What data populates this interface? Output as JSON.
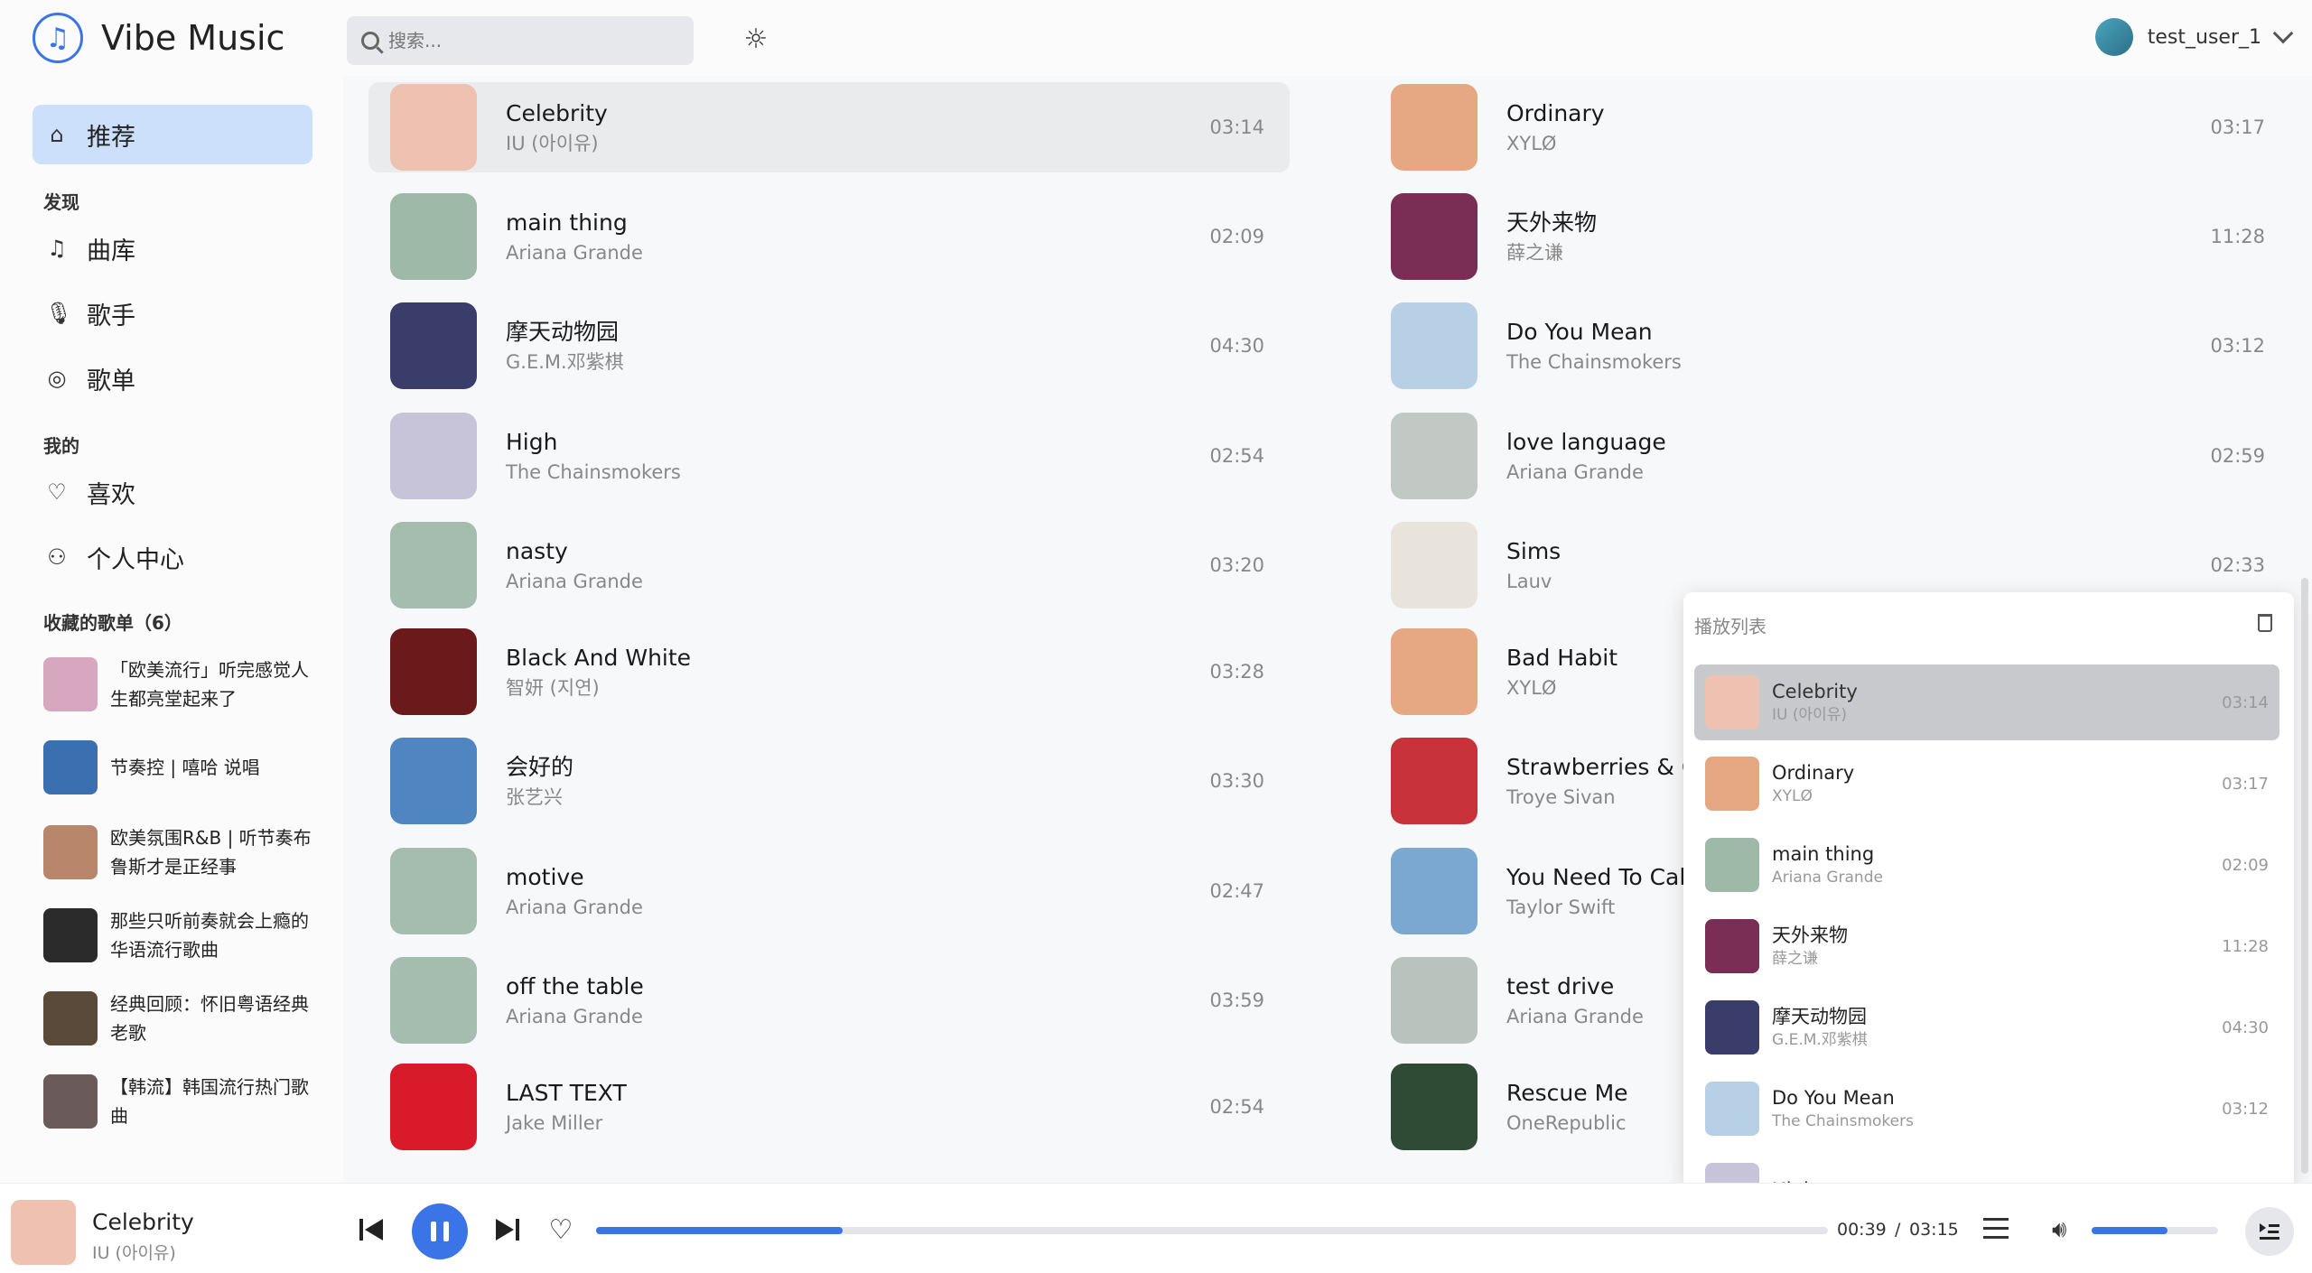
{
  "header": {
    "app_name": "Vibe Music",
    "search_placeholder": "搜索...",
    "username": "test_user_1"
  },
  "sidebar": {
    "recommend": "推荐",
    "discover_label": "发现",
    "library": "曲库",
    "artists": "歌手",
    "playlists": "歌单",
    "mine_label": "我的",
    "likes": "喜欢",
    "profile": "个人中心",
    "collected_label": "收藏的歌单（6）",
    "collected": [
      {
        "title": "「欧美流行」听完感觉人生都亮堂起来了",
        "color": "#d7a7c0"
      },
      {
        "title": "节奏控 | 嘻哈 说唱",
        "color": "#3a6fb0"
      },
      {
        "title": "欧美氛围R&B  |  听节奏布鲁斯才是正经事",
        "color": "#b8866b"
      },
      {
        "title": "那些只听前奏就会上瘾的华语流行歌曲",
        "color": "#2b2b2b"
      },
      {
        "title": "经典回顾：怀旧粤语经典老歌",
        "color": "#5a4a3a"
      },
      {
        "title": "【韩流】韩国流行热门歌曲",
        "color": "#6b5a5a"
      }
    ]
  },
  "songs_left": [
    {
      "title": "Celebrity",
      "artist": "IU (아이유)",
      "time": "03:14",
      "color": "#eec1b0"
    },
    {
      "title": "main thing",
      "artist": "Ariana Grande",
      "time": "02:09",
      "color": "#9fb9a8"
    },
    {
      "title": "摩天动物园",
      "artist": "G.E.M.邓紫棋",
      "time": "04:30",
      "color": "#3a3c6a"
    },
    {
      "title": "High",
      "artist": "The Chainsmokers",
      "time": "02:54",
      "color": "#c7c4d9"
    },
    {
      "title": "nasty",
      "artist": "Ariana Grande",
      "time": "03:20",
      "color": "#a5bdaf"
    },
    {
      "title": "Black And White",
      "artist": "智妍 (지연)",
      "time": "03:28",
      "color": "#6a1a1a"
    },
    {
      "title": "会好的",
      "artist": "张艺兴",
      "time": "03:30",
      "color": "#4f86c2"
    },
    {
      "title": "motive",
      "artist": "Ariana Grande",
      "time": "02:47",
      "color": "#a5bdaf"
    },
    {
      "title": "off the table",
      "artist": "Ariana Grande",
      "time": "03:59",
      "color": "#a5bdaf"
    },
    {
      "title": "LAST TEXT",
      "artist": "Jake Miller",
      "time": "02:54",
      "color": "#d81a2a"
    }
  ],
  "songs_right": [
    {
      "title": "Ordinary",
      "artist": "XYLØ",
      "time": "03:17",
      "color": "#e6a882"
    },
    {
      "title": "天外来物",
      "artist": "薛之谦",
      "time": "11:28",
      "color": "#7a2e55"
    },
    {
      "title": "Do You Mean",
      "artist": "The Chainsmokers",
      "time": "03:12",
      "color": "#b8d0e6"
    },
    {
      "title": "love language",
      "artist": "Ariana Grande",
      "time": "02:59",
      "color": "#c2c8c4"
    },
    {
      "title": "Sims",
      "artist": "Lauv",
      "time": "02:33",
      "color": "#e8e4dc"
    },
    {
      "title": "Bad Habit",
      "artist": "XYLØ",
      "time": "",
      "color": "#e6a882"
    },
    {
      "title": "Strawberries & Ciga",
      "artist": "Troye Sivan",
      "time": "",
      "color": "#c8323a"
    },
    {
      "title": "You Need To Calm I",
      "artist": "Taylor Swift",
      "time": "",
      "color": "#7aa8d0"
    },
    {
      "title": "test drive",
      "artist": "Ariana Grande",
      "time": "",
      "color": "#b9c2bc"
    },
    {
      "title": "Rescue Me",
      "artist": "OneRepublic",
      "time": "",
      "color": "#2f4a35"
    }
  ],
  "queue": {
    "title": "播放列表",
    "items": [
      {
        "title": "Celebrity",
        "artist": "IU (아이유)",
        "time": "03:14",
        "color": "#eec1b0"
      },
      {
        "title": "Ordinary",
        "artist": "XYLØ",
        "time": "03:17",
        "color": "#e6a882"
      },
      {
        "title": "main thing",
        "artist": "Ariana Grande",
        "time": "02:09",
        "color": "#9fb9a8"
      },
      {
        "title": "天外来物",
        "artist": "薛之谦",
        "time": "11:28",
        "color": "#7a2e55"
      },
      {
        "title": "摩天动物园",
        "artist": "G.E.M.邓紫棋",
        "time": "04:30",
        "color": "#3a3c6a"
      },
      {
        "title": "Do You Mean",
        "artist": "The Chainsmokers",
        "time": "03:12",
        "color": "#b8d0e6"
      },
      {
        "title": "High",
        "artist": "",
        "time": "",
        "color": "#c7c4d9"
      }
    ]
  },
  "player": {
    "title": "Celebrity",
    "artist": "IU (아이유)",
    "current_time": "00:39",
    "separator": "/",
    "total_time": "03:15",
    "progress": 0.2,
    "volume": 0.6,
    "accent": "#3b74e6"
  }
}
